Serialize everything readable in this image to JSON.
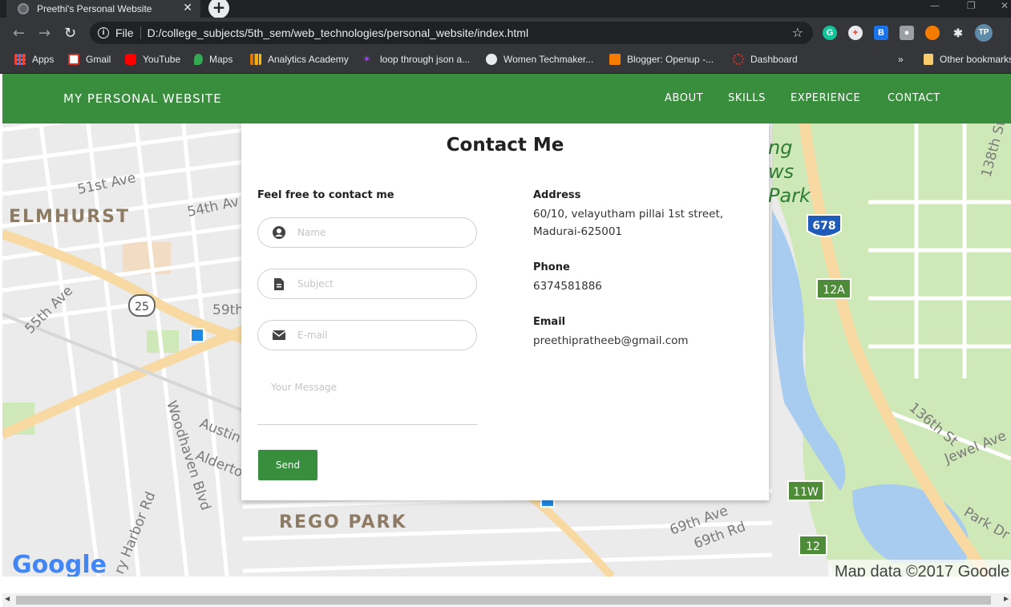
{
  "browser": {
    "tab_title": "Preethi's Personal Website",
    "tab_close": "✕",
    "new_tab": "+",
    "url_scheme": "File",
    "url": "D:/college_subjects/5th_sem/web_technologies/personal_website/index.html",
    "profile_initials": "TP",
    "bookmarks": [
      {
        "label": "Apps",
        "icon_color": "#ea4335"
      },
      {
        "label": "Gmail",
        "icon_color": "#d93025"
      },
      {
        "label": "YouTube",
        "icon_color": "#ff0000"
      },
      {
        "label": "Maps",
        "icon_color": "#34a853"
      },
      {
        "label": "Analytics Academy",
        "icon_color": "#f9ab00"
      },
      {
        "label": "loop through json a...",
        "icon_color": "#a142f4"
      },
      {
        "label": "Women Techmaker...",
        "icon_color": "#e8eaed"
      },
      {
        "label": "Blogger: Openup -...",
        "icon_color": "#f57c00"
      },
      {
        "label": "Dashboard",
        "icon_color": "#d93025"
      }
    ],
    "bookmarks_overflow": "»",
    "other_bookmarks": "Other bookmarks"
  },
  "navbar": {
    "brand": "MY PERSONAL WEBSITE",
    "links": [
      "ABOUT",
      "SKILLS",
      "EXPERIENCE",
      "CONTACT"
    ],
    "color": "#388e3c"
  },
  "map": {
    "labels": [
      "51st Ave",
      "ELMHURST",
      "54th Av",
      "55th Ave",
      "59th",
      "Woodhaven Blvd",
      "Austin",
      "Alderton",
      "ry Harbor Rd",
      "REGO PARK",
      "69th Ave",
      "69th Rd",
      "136th St",
      "Jewel Ave",
      "Park Dr",
      "138th St",
      "ng",
      "ws",
      "Park"
    ],
    "shields": [
      "25",
      "678",
      "12A",
      "11W",
      "12"
    ],
    "google_logo": "Google",
    "attribution": "Map data ©2017 Google"
  },
  "contact": {
    "title": "Contact Me",
    "intro": "Feel free to contact me",
    "form": {
      "name_placeholder": "Name",
      "subject_placeholder": "Subject",
      "email_placeholder": "E-mail",
      "message_placeholder": "Your Message",
      "send_label": "Send"
    },
    "address_label": "Address",
    "address_line1": "60/10, velayutham pillai 1st street,",
    "address_line2": "Madurai-625001",
    "phone_label": "Phone",
    "phone": "6374581886",
    "email_label": "Email",
    "email": "preethipratheeb@gmail.com"
  }
}
